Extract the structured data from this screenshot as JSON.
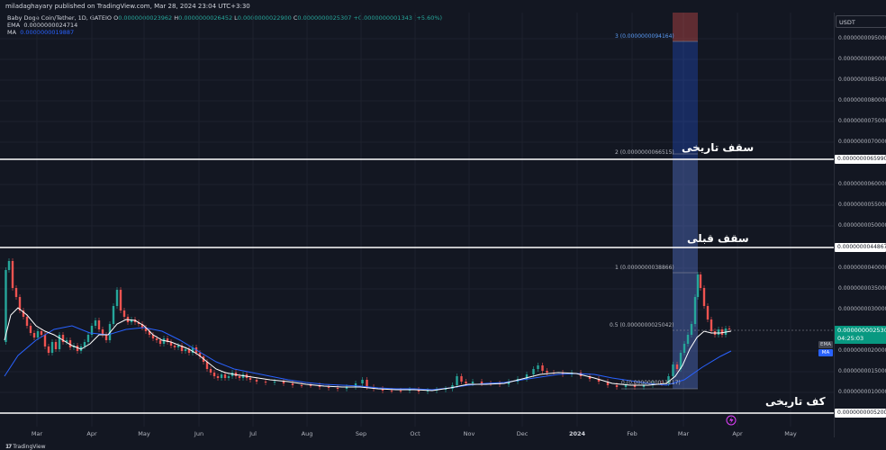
{
  "header": {
    "publisher_line": "miladaghayary published on TradingView.com, Mar 28, 2024 23:04 UTC+3:30"
  },
  "legend": {
    "symbol": "Baby Doge Coin/Tether, 1D, GATEIO",
    "o_label": "O",
    "o_value": "0.0000000023962",
    "h_label": "H",
    "h_value": "0.0000000026452",
    "l_label": "L",
    "l_value": "0.0000000022900",
    "c_label": "C",
    "c_value": "0.0000000025307",
    "change": "+0.0000000001343 (+5.60%)",
    "ema_label": "EMA",
    "ema_value": "0.0000000024714",
    "ma_label": "MA",
    "ma_value": "0.0000000019887"
  },
  "price_axis": {
    "currency": "USDT",
    "ticks": [
      "0.0000000095000",
      "0.0000000090000",
      "0.0000000085000",
      "0.0000000080000",
      "0.0000000075000",
      "0.0000000070000",
      "0.0000000060000",
      "0.0000000055000",
      "0.0000000050000",
      "0.0000000040000",
      "0.0000000035000",
      "0.0000000030000",
      "0.0000000020000",
      "0.0000000015000",
      "0.0000000010000"
    ],
    "hline_labels": [
      "0.0000000065990",
      "0.0000000044867",
      "0.0000000005200"
    ],
    "current_price": "0.0000000025307",
    "countdown": "04:25:03",
    "ema_badge": "EMA",
    "ma_badge": "MA"
  },
  "annotations": {
    "ath_top": "سقف تاریخی",
    "prev_top": "سقف قبلی",
    "ath_bottom": "کف تاریخی"
  },
  "fib_labels": {
    "f3": "3 (0.0000000094164)",
    "f2": "2 (0.0000000066515)",
    "f1": "1 (0.0000000038866)",
    "f05": "0.5 (0.0000000025042)",
    "f0": "0 (0.0000000011217)"
  },
  "time_axis": [
    "Mar",
    "Apr",
    "May",
    "Jun",
    "Jul",
    "Aug",
    "Sep",
    "Oct",
    "Nov",
    "Dec",
    "2024",
    "Feb",
    "Mar",
    "Apr",
    "May"
  ],
  "footer": {
    "brand": "TradingView"
  },
  "colors": {
    "up": "#26a69a",
    "down": "#ef5350",
    "ema": "#ffffff",
    "ma": "#2962ff",
    "background": "#131722"
  }
}
